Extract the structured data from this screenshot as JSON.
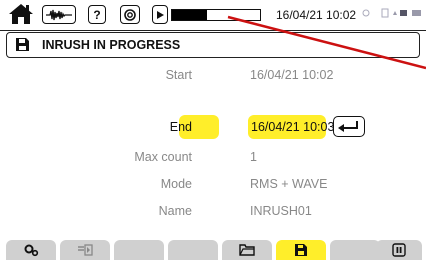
{
  "status_bar": {
    "datetime": "16/04/21 10:02",
    "progress_fraction": 0.4,
    "status_icons_text": "⚬ ⬡ ⬣ ❙❙"
  },
  "header": {
    "title": "INRUSH IN PROGRESS"
  },
  "form": {
    "start_label": "Start",
    "start_value": "16/04/21 10:02",
    "end_label": "End",
    "end_value": "16/04/21 10:03",
    "max_count_label": "Max count",
    "max_count_value": "1",
    "mode_label": "Mode",
    "mode_value": "RMS + WAVE",
    "name_label": "Name",
    "name_value": "INRUSH01"
  },
  "colors": {
    "highlight": "#ffee2a",
    "tab_inactive": "#d0d0d0",
    "annotation_arrow": "#cc1111"
  },
  "icons": {
    "home": "home-icon",
    "waveform": "waveform-icon",
    "help": "help-icon",
    "camera": "camera-icon",
    "play": "play-icon",
    "save": "save-icon",
    "enter": "enter-icon",
    "settings": "gear-icon",
    "export": "export-icon",
    "folder": "folder-icon",
    "pause": "pause-icon"
  }
}
